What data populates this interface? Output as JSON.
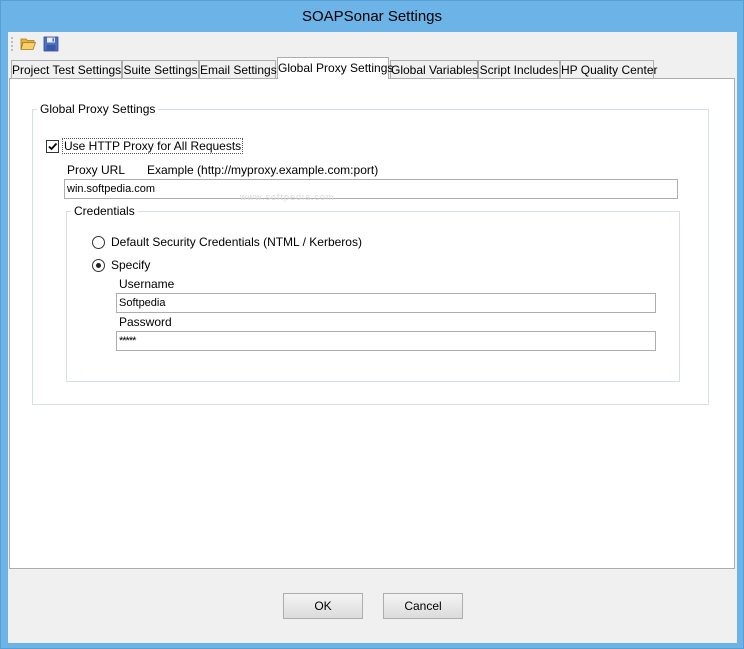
{
  "window": {
    "title": "SOAPSonar Settings"
  },
  "toolbar": {
    "open_icon": "folder-open-icon",
    "save_icon": "save-disk-icon"
  },
  "tabs": [
    {
      "label": "Project Test Settings"
    },
    {
      "label": "Suite Settings"
    },
    {
      "label": "Email Settings"
    },
    {
      "label": "Global Proxy Settings",
      "active": true
    },
    {
      "label": "Global Variables"
    },
    {
      "label": "Script Includes"
    },
    {
      "label": "HP Quality Center"
    }
  ],
  "proxy": {
    "group_label": "Global Proxy Settings",
    "use_proxy_label": "Use HTTP Proxy for All Requests",
    "use_proxy_checked": true,
    "url_label": "Proxy URL",
    "url_example": "Example (http://myproxy.example.com:port)",
    "url_value": "win.softpedia.com",
    "watermark": "www.softpedia.com"
  },
  "credentials": {
    "group_label": "Credentials",
    "default_label": "Default Security Credentials (NTML / Kerberos)",
    "specify_label": "Specify",
    "selected": "specify",
    "username_label": "Username",
    "username_value": "Softpedia",
    "password_label": "Password",
    "password_value": "*****"
  },
  "buttons": {
    "ok": "OK",
    "cancel": "Cancel"
  }
}
